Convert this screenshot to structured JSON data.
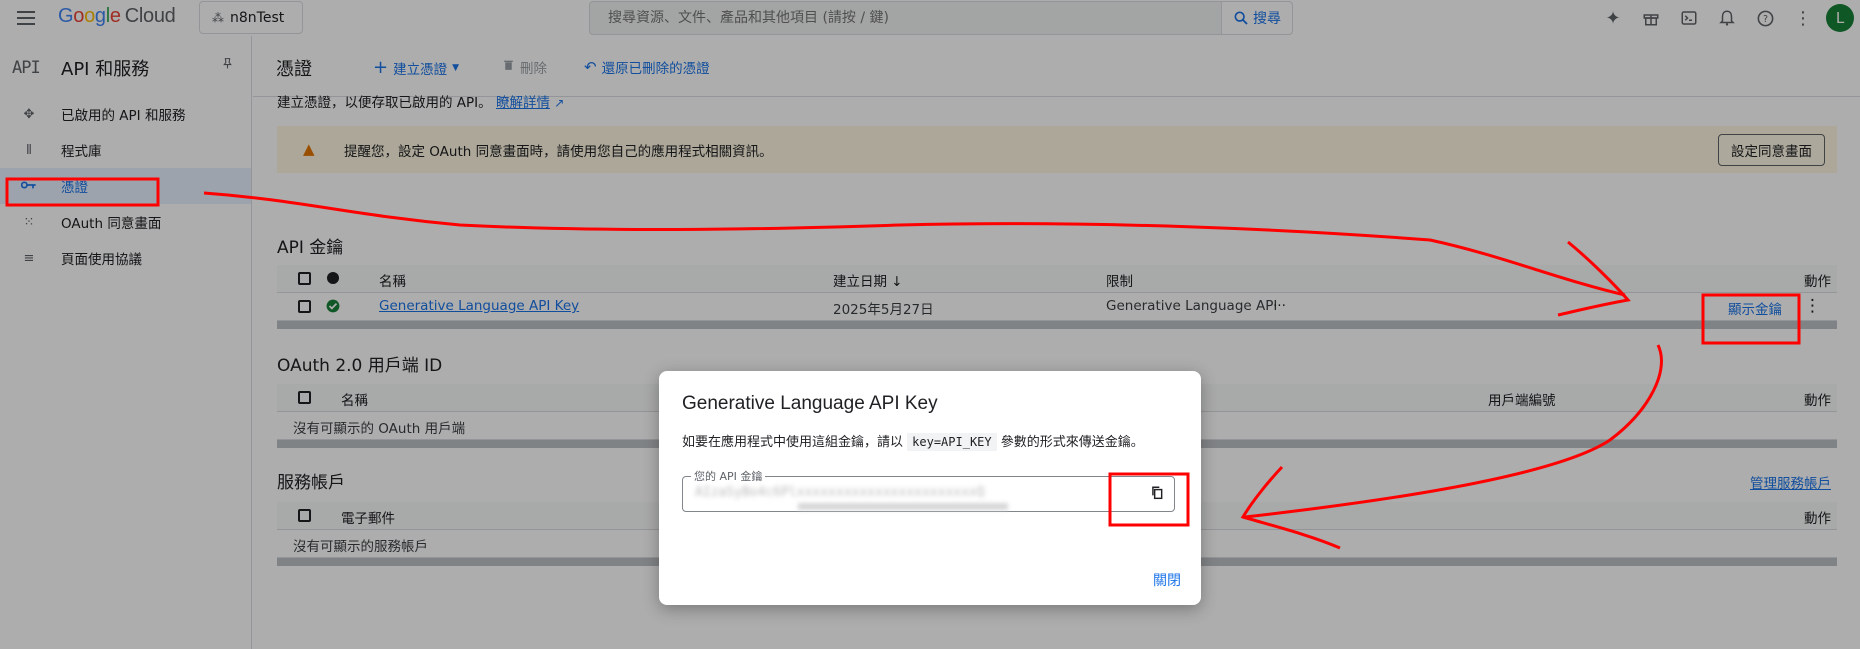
{
  "topbar": {
    "logo_google": "Google",
    "logo_cloud": "Cloud",
    "project": "n8nTest",
    "search_placeholder": "搜尋資源、文件、產品和其他項目 (請按 / 鍵)",
    "search_button": "搜尋",
    "avatar_letter": "L"
  },
  "sidebar": {
    "logo": "API",
    "title": "API 和服務",
    "items": [
      {
        "label": "已啟用的 API 和服務",
        "icon": "apis-icon"
      },
      {
        "label": "程式庫",
        "icon": "library-icon"
      },
      {
        "label": "憑證",
        "icon": "key-icon",
        "active": true
      },
      {
        "label": "OAuth 同意畫面",
        "icon": "oauth-icon"
      },
      {
        "label": "頁面使用協議",
        "icon": "settings-list-icon"
      }
    ]
  },
  "toolbar": {
    "page_title": "憑證",
    "create": "建立憑證",
    "delete": "刪除",
    "restore": "還原已刪除的憑證"
  },
  "content": {
    "desc": "建立憑證，以便存取已啟用的 API。",
    "learn_more": "瞭解詳情",
    "banner_text": "提醒您，設定 OAuth 同意畫面時，請使用您自己的應用程式相關資訊。",
    "banner_button": "設定同意畫面",
    "api_keys": {
      "title": "API 金鑰",
      "headers": {
        "name": "名稱",
        "date": "建立日期",
        "restriction": "限制",
        "actions": "動作"
      },
      "rows": [
        {
          "name": "Generative Language API Key",
          "date": "2025年5月27日",
          "restriction": "Generative Language API",
          "more": "···",
          "show_key": "顯示金鑰"
        }
      ]
    },
    "oauth": {
      "title": "OAuth 2.0 用戶端 ID",
      "headers": {
        "name": "名稱",
        "client_id": "用戶端編號",
        "actions": "動作"
      },
      "empty": "沒有可顯示的 OAuth 用戶端"
    },
    "service_accounts": {
      "title": "服務帳戶",
      "manage": "管理服務帳戶",
      "headers": {
        "email": "電子郵件",
        "actions": "動作"
      },
      "empty": "沒有可顯示的服務帳戶"
    }
  },
  "dialog": {
    "title": "Generative Language API Key",
    "text_before": "如要在應用程式中使用這組金鑰，請以",
    "code": "key=API_KEY",
    "text_after": "參數的形式來傳送金鑰。",
    "key_label": "您的 API 金鑰",
    "key_value": "AIzaSyBo4c6PlxxxxxxxxxxxxxxxxxxxxxxxQ",
    "close": "關閉"
  },
  "colors": {
    "accent": "#1a73e8",
    "annotation": "#ff0000",
    "warning_bg": "#fef7e0"
  }
}
